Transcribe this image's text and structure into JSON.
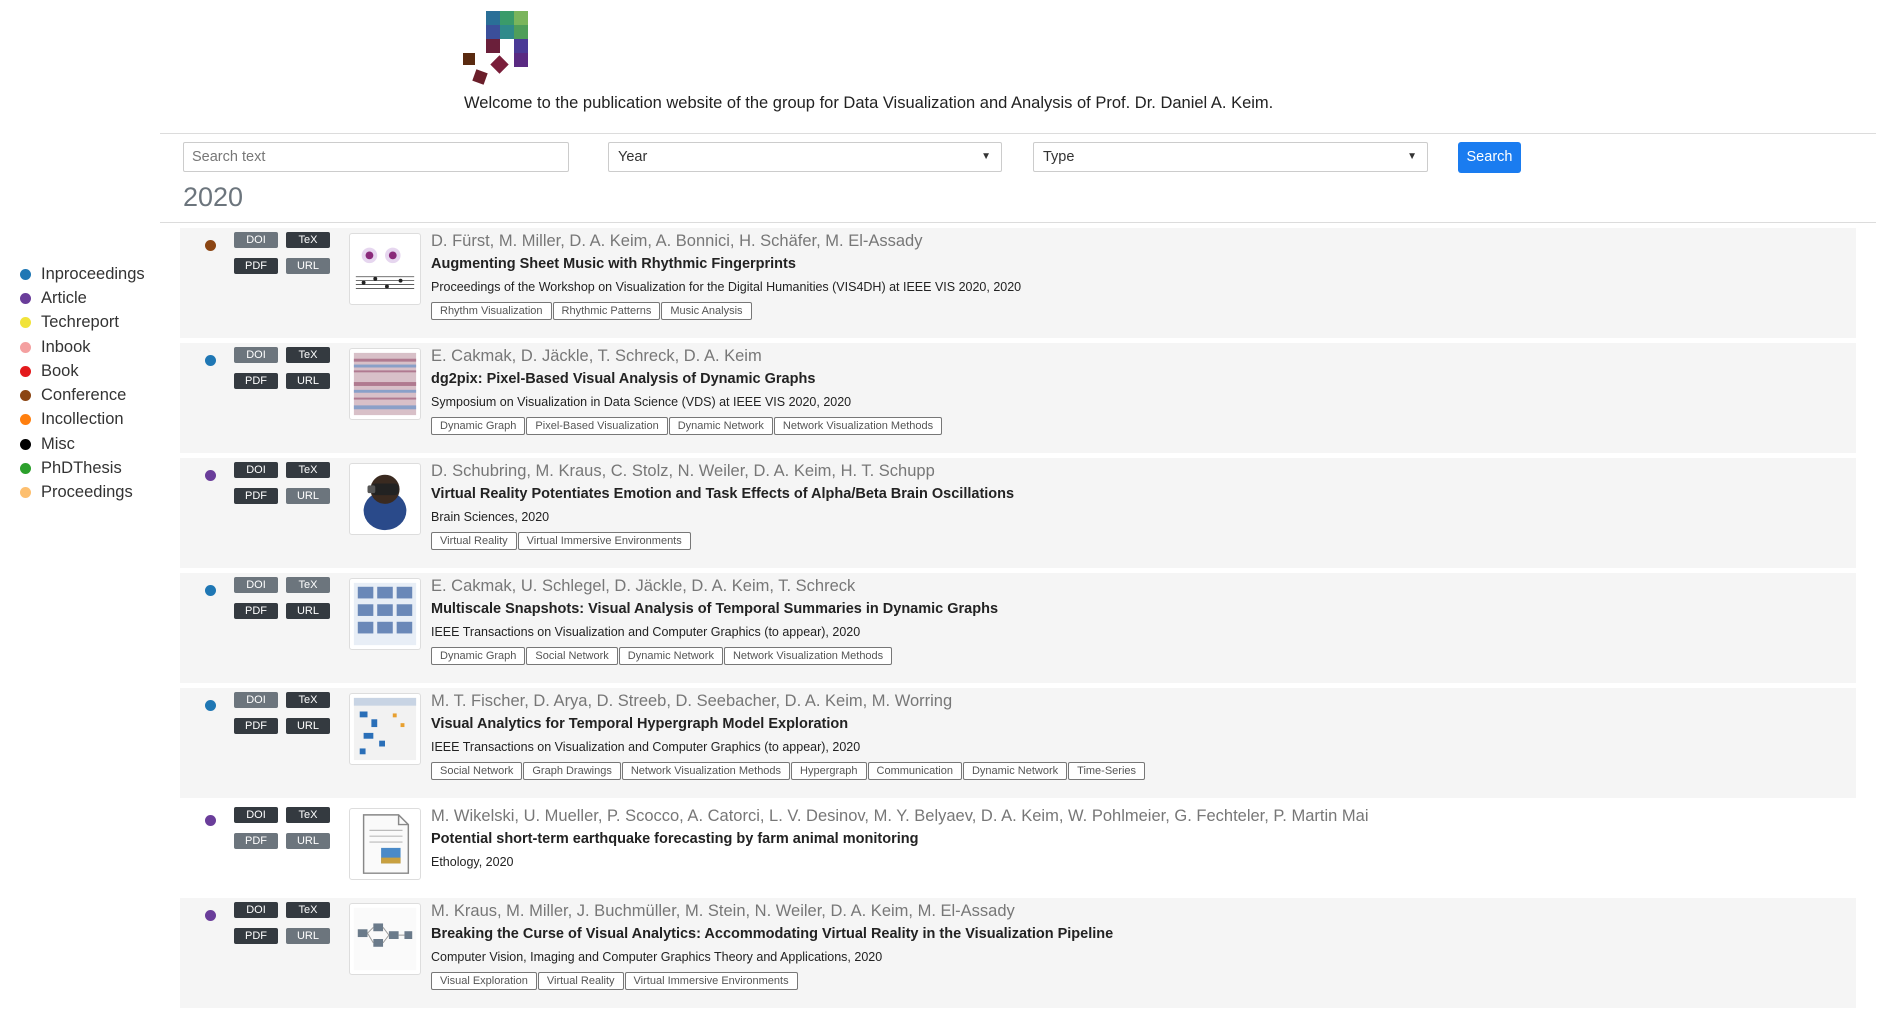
{
  "header": {
    "welcome": "Welcome to the publication website of the group for Data Visualization and Analysis of Prof. Dr. Daniel A. Keim."
  },
  "search": {
    "placeholder": "Search text",
    "year_label": "Year",
    "type_label": "Type",
    "button": "Search"
  },
  "year_heading": "2020",
  "legend": [
    {
      "label": "Inproceedings",
      "color": "#1f77b4"
    },
    {
      "label": "Article",
      "color": "#6a3d9a"
    },
    {
      "label": "Techreport",
      "color": "#f1e33a"
    },
    {
      "label": "Inbook",
      "color": "#f4a0a0"
    },
    {
      "label": "Book",
      "color": "#e31a1c"
    },
    {
      "label": "Conference",
      "color": "#8b4513"
    },
    {
      "label": "Incollection",
      "color": "#ff7f0e"
    },
    {
      "label": "Misc",
      "color": "#000000"
    },
    {
      "label": "PhDThesis",
      "color": "#2ca02c"
    },
    {
      "label": "Proceedings",
      "color": "#fdbf6f"
    }
  ],
  "buttons": {
    "doi": "DOI",
    "tex": "TeX",
    "pdf": "PDF",
    "url": "URL"
  },
  "publications": [
    {
      "type_color": "#8b4513",
      "doi_style": "gray",
      "tex_style": "dark",
      "pdf_style": "dark",
      "url_style": "gray",
      "authors": "D. Fürst, M. Miller, D. A. Keim, A. Bonnici, H. Schäfer, M. El-Assady",
      "title": "Augmenting Sheet Music with Rhythmic Fingerprints",
      "venue": "Proceedings of the Workshop on Visualization for the Digital Humanities (VIS4DH) at IEEE VIS 2020, 2020",
      "tags": [
        "Rhythm Visualization",
        "Rhythmic Patterns",
        "Music Analysis"
      ],
      "thumb_icon": "sheet-music-thumbnail"
    },
    {
      "type_color": "#1f77b4",
      "doi_style": "gray",
      "tex_style": "dark",
      "pdf_style": "dark",
      "url_style": "dark",
      "authors": "E. Cakmak, D. Jäckle, T. Schreck, D. A. Keim",
      "title": "dg2pix: Pixel-Based Visual Analysis of Dynamic Graphs",
      "venue": "Symposium on Visualization in Data Science (VDS) at IEEE VIS 2020, 2020",
      "tags": [
        "Dynamic Graph",
        "Pixel-Based Visualization",
        "Dynamic Network",
        "Network Visualization Methods"
      ],
      "thumb_icon": "pixel-heatmap-thumbnail"
    },
    {
      "type_color": "#6a3d9a",
      "doi_style": "dark",
      "tex_style": "dark",
      "pdf_style": "dark",
      "url_style": "gray",
      "authors": "D. Schubring, M. Kraus, C. Stolz, N. Weiler, D. A. Keim, H. T. Schupp",
      "title": "Virtual Reality Potentiates Emotion and Task Effects of Alpha/Beta Brain Oscillations",
      "venue": "Brain Sciences, 2020",
      "tags": [
        "Virtual Reality",
        "Virtual Immersive Environments"
      ],
      "thumb_icon": "vr-headset-thumbnail"
    },
    {
      "type_color": "#1f77b4",
      "doi_style": "gray",
      "tex_style": "gray",
      "pdf_style": "dark",
      "url_style": "dark",
      "authors": "E. Cakmak, U. Schlegel, D. Jäckle, D. A. Keim, T. Schreck",
      "title": "Multiscale Snapshots: Visual Analysis of Temporal Summaries in Dynamic Graphs",
      "venue": "IEEE Transactions on Visualization and Computer Graphics (to appear), 2020",
      "tags": [
        "Dynamic Graph",
        "Social Network",
        "Dynamic Network",
        "Network Visualization Methods"
      ],
      "thumb_icon": "snapshot-grid-thumbnail"
    },
    {
      "type_color": "#1f77b4",
      "doi_style": "gray",
      "tex_style": "dark",
      "pdf_style": "dark",
      "url_style": "dark",
      "authors": "M. T. Fischer, D. Arya, D. Streeb, D. Seebacher, D. A. Keim, M. Worring",
      "title": "Visual Analytics for Temporal Hypergraph Model Exploration",
      "venue": "IEEE Transactions on Visualization and Computer Graphics (to appear), 2020",
      "tags": [
        "Social Network",
        "Graph Drawings",
        "Network Visualization Methods",
        "Hypergraph",
        "Communication",
        "Dynamic Network",
        "Time-Series"
      ],
      "thumb_icon": "hypergraph-thumbnail"
    },
    {
      "type_color": "#6a3d9a",
      "doi_style": "dark",
      "tex_style": "dark",
      "pdf_style": "gray",
      "url_style": "gray",
      "authors": "M. Wikelski, U. Mueller, P. Scocco, A. Catorci, L. V. Desinov, M. Y. Belyaev, D. A. Keim, W. Pohlmeier, G. Fechteler, P. Martin Mai",
      "title": "Potential short-term earthquake forecasting by farm animal monitoring",
      "venue": "Ethology, 2020",
      "tags": [],
      "thumb_icon": "document-thumbnail"
    },
    {
      "type_color": "#6a3d9a",
      "doi_style": "dark",
      "tex_style": "dark",
      "pdf_style": "dark",
      "url_style": "gray",
      "authors": "M. Kraus, M. Miller, J. Buchmüller, M. Stein, N. Weiler, D. A. Keim, M. El-Assady",
      "title": "Breaking the Curse of Visual Analytics: Accommodating Virtual Reality in the Visualization Pipeline",
      "venue": "Computer Vision, Imaging and Computer Graphics Theory and Applications, 2020",
      "tags": [
        "Visual Exploration",
        "Virtual Reality",
        "Virtual Immersive Environments"
      ],
      "thumb_icon": "pipeline-diagram-thumbnail"
    }
  ]
}
